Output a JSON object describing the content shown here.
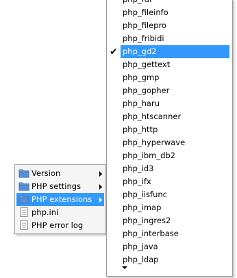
{
  "left_menu": {
    "items": [
      {
        "label": "Version",
        "icon": "folder-icon",
        "submenu": true
      },
      {
        "label": "PHP settings",
        "icon": "folder-icon",
        "submenu": true
      },
      {
        "label": "PHP extensions",
        "icon": "folder-icon",
        "submenu": true,
        "highlighted": true
      },
      {
        "label": "php.ini",
        "icon": "document-icon",
        "submenu": false
      },
      {
        "label": "PHP error log",
        "icon": "document-icon",
        "submenu": false
      }
    ]
  },
  "extensions_menu": {
    "items": [
      {
        "label": "php_fdf"
      },
      {
        "label": "php_fileinfo"
      },
      {
        "label": "php_filepro"
      },
      {
        "label": "php_fribidi"
      },
      {
        "label": "php_gd2",
        "checked": true,
        "highlighted": true
      },
      {
        "label": "php_gettext"
      },
      {
        "label": "php_gmp"
      },
      {
        "label": "php_gopher"
      },
      {
        "label": "php_haru"
      },
      {
        "label": "php_htscanner"
      },
      {
        "label": "php_http"
      },
      {
        "label": "php_hyperwave"
      },
      {
        "label": "php_ibm_db2"
      },
      {
        "label": "php_id3"
      },
      {
        "label": "php_ifx"
      },
      {
        "label": "php_iisfunc"
      },
      {
        "label": "php_imap"
      },
      {
        "label": "php_ingres2"
      },
      {
        "label": "php_interbase"
      },
      {
        "label": "php_java"
      },
      {
        "label": "php_ldap"
      }
    ],
    "checkmark": "✔",
    "scroll_icon": "chevron-down-icon"
  },
  "colors": {
    "highlight": "#3399ff",
    "menu_bg": "#f5f5f5",
    "border": "#9a9a9a",
    "folder": "#5a8fd6"
  }
}
